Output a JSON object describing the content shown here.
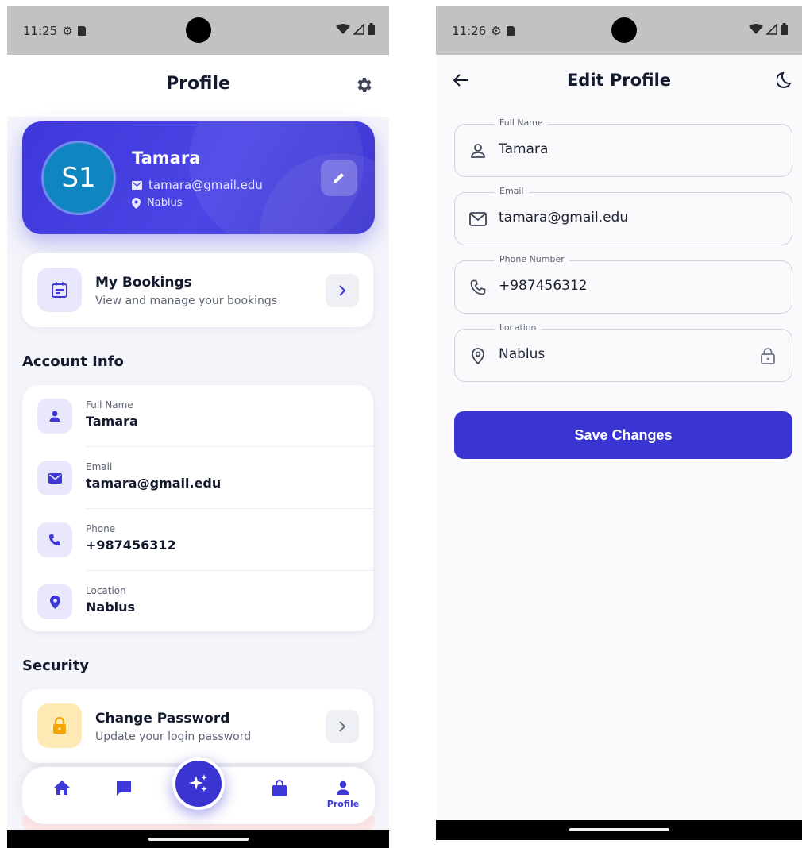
{
  "left": {
    "status": {
      "time": "11:25"
    },
    "header": {
      "title": "Profile"
    },
    "profile": {
      "initials": "S1",
      "name": "Tamara",
      "email": "tamara@gmail.edu",
      "location": "Nablus"
    },
    "bookings": {
      "title": "My Bookings",
      "subtitle": "View and manage your bookings"
    },
    "account_info": {
      "title": "Account Info",
      "items": [
        {
          "label": "Full Name",
          "value": "Tamara",
          "icon": "person-icon"
        },
        {
          "label": "Email",
          "value": "tamara@gmail.edu",
          "icon": "mail-icon"
        },
        {
          "label": "Phone",
          "value": "+987456312",
          "icon": "phone-icon"
        },
        {
          "label": "Location",
          "value": "Nablus",
          "icon": "location-pin-icon"
        }
      ]
    },
    "security": {
      "title": "Security",
      "change_password": {
        "title": "Change Password",
        "subtitle": "Update your login password"
      }
    },
    "bottom_nav": {
      "active_label": "Profile",
      "items": [
        "home-icon",
        "chat-icon",
        "sparkle-icon",
        "bag-icon",
        "person-icon"
      ]
    }
  },
  "right": {
    "status": {
      "time": "11:26"
    },
    "header": {
      "title": "Edit Profile"
    },
    "fields": [
      {
        "label": "Full Name",
        "value": "Tamara",
        "icon": "person-outline-icon",
        "locked": false
      },
      {
        "label": "Email",
        "value": "tamara@gmail.edu",
        "icon": "mail-outline-icon",
        "locked": false
      },
      {
        "label": "Phone Number",
        "value": "+987456312",
        "icon": "phone-outline-icon",
        "locked": false
      },
      {
        "label": "Location",
        "value": "Nablus",
        "icon": "location-outline-icon",
        "locked": true
      }
    ],
    "save_label": "Save Changes"
  },
  "colors": {
    "primary": "#3a35d2",
    "card_gradient_start": "#3f37d9",
    "avatar_bg": "#0f86c0",
    "text_dark": "#141a2e",
    "text_muted": "#5e6475",
    "tile_purple": "#e8e7fb",
    "tile_yellow": "#fde9b3",
    "lock_orange": "#f4a500"
  }
}
